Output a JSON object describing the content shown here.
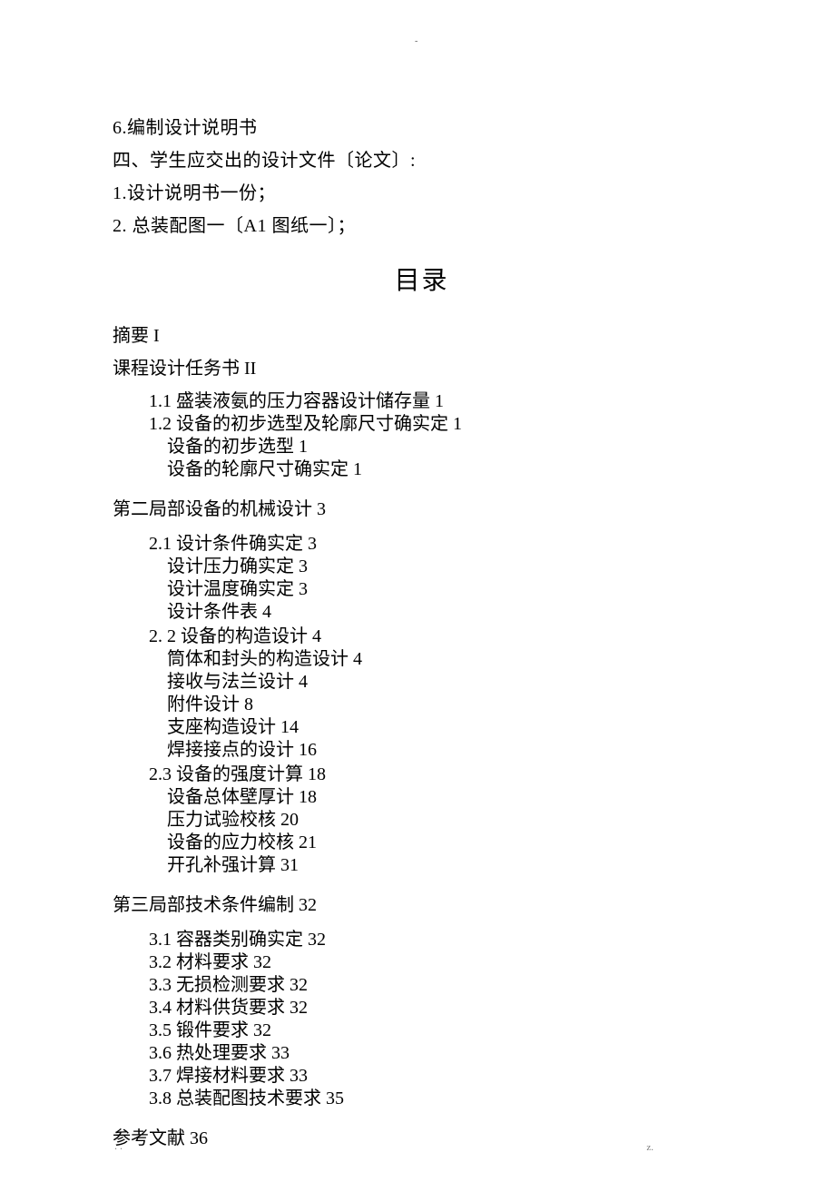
{
  "header_mark": "-",
  "intro": {
    "line1": "6.编制设计说明书",
    "line2": "四、学生应交出的设计文件〔论文〕:",
    "line3": "1.设计说明书一份；",
    "line4": "2. 总装配图一〔A1 图纸一〕；"
  },
  "toc_title": "目录",
  "abstract": "摘要 I",
  "taskbook": "课程设计任务书 II",
  "s1_1": "1.1 盛装液氨的压力容器设计储存量 1",
  "s1_2": "1.2 设备的初步选型及轮廓尺寸确实定 1",
  "s1_2_1": "设备的初步选型 1",
  "s1_2_2": "设备的轮廓尺寸确实定 1",
  "part2": "第二局部设备的机械设计 3",
  "s2_1": "2.1 设计条件确实定 3",
  "s2_1_1": "设计压力确实定 3",
  "s2_1_2": "设计温度确实定 3",
  "s2_1_3": "设计条件表 4",
  "s2_2": "2. 2 设备的构造设计 4",
  "s2_2_1": "筒体和封头的构造设计 4",
  "s2_2_2": "接收与法兰设计 4",
  "s2_2_3": "附件设计 8",
  "s2_2_4": "支座构造设计 14",
  "s2_2_5": "焊接接点的设计 16",
  "s2_3": "2.3 设备的强度计算 18",
  "s2_3_1": "设备总体壁厚计 18",
  "s2_3_2": "压力试验校核 20",
  "s2_3_3": "设备的应力校核 21",
  "s2_3_4": "开孔补强计算 31",
  "part3": "第三局部技术条件编制 32",
  "s3_1": "3.1 容器类别确实定 32",
  "s3_2": "3.2 材料要求 32",
  "s3_3": "3.3 无损检测要求 32",
  "s3_4": "3.4 材料供货要求 32",
  "s3_5": "3.5 锻件要求 32",
  "s3_6": "3.6 热处理要求 33",
  "s3_7": "3.7 焊接材料要求 33",
  "s3_8": "3.8 总装配图技术要求 35",
  "refs": "参考文献 36",
  "footer_left": ".  .",
  "footer_right": "z."
}
